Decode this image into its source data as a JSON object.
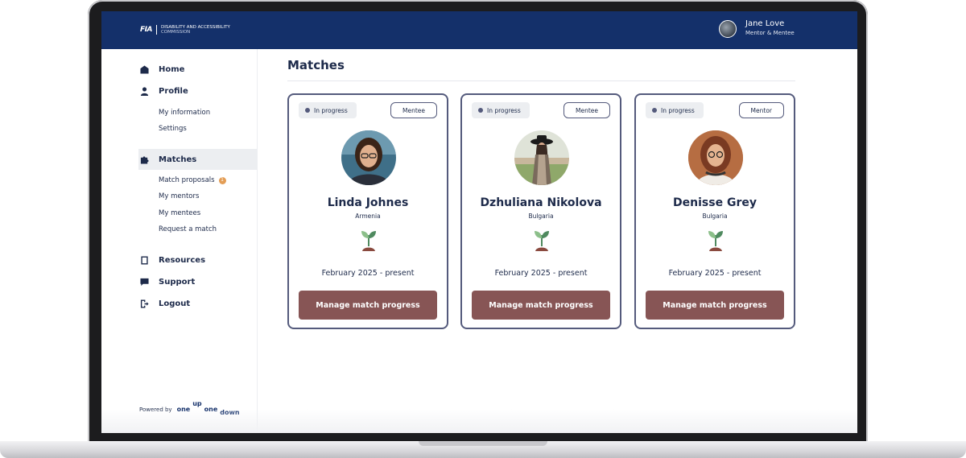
{
  "header": {
    "brand_mark": "FIA",
    "brand_line1": "Disability and Accessibility",
    "brand_line2": "Commission",
    "user_name": "Jane Love",
    "user_role": "Mentor & Mentee"
  },
  "sidebar": {
    "home": "Home",
    "profile": "Profile",
    "my_information": "My information",
    "settings": "Settings",
    "matches": "Matches",
    "match_proposals": "Match proposals",
    "match_proposals_count": "1",
    "my_mentors": "My mentors",
    "my_mentees": "My mentees",
    "request_a_match": "Request a match",
    "resources": "Resources",
    "support": "Support",
    "logout": "Logout",
    "powered_by": "Powered by",
    "logo_one": "one",
    "logo_up": "up",
    "logo_one2": "one",
    "logo_down": "down"
  },
  "main": {
    "title": "Matches",
    "cards": [
      {
        "status": "In progress",
        "role": "Mentee",
        "name": "Linda Johnes",
        "country": "Armenia",
        "period": "February 2025 - present",
        "button": "Manage match progress"
      },
      {
        "status": "In progress",
        "role": "Mentee",
        "name": "Dzhuliana Nikolova",
        "country": "Bulgaria",
        "period": "February 2025 - present",
        "button": "Manage match progress"
      },
      {
        "status": "In progress",
        "role": "Mentor",
        "name": "Denisse Grey",
        "country": "Bulgaria",
        "period": "February 2025 - present",
        "button": "Manage match progress"
      }
    ]
  },
  "colors": {
    "topbar": "#14306a",
    "card_border": "#545a7c",
    "button": "#875555",
    "badge": "#e39d55"
  }
}
